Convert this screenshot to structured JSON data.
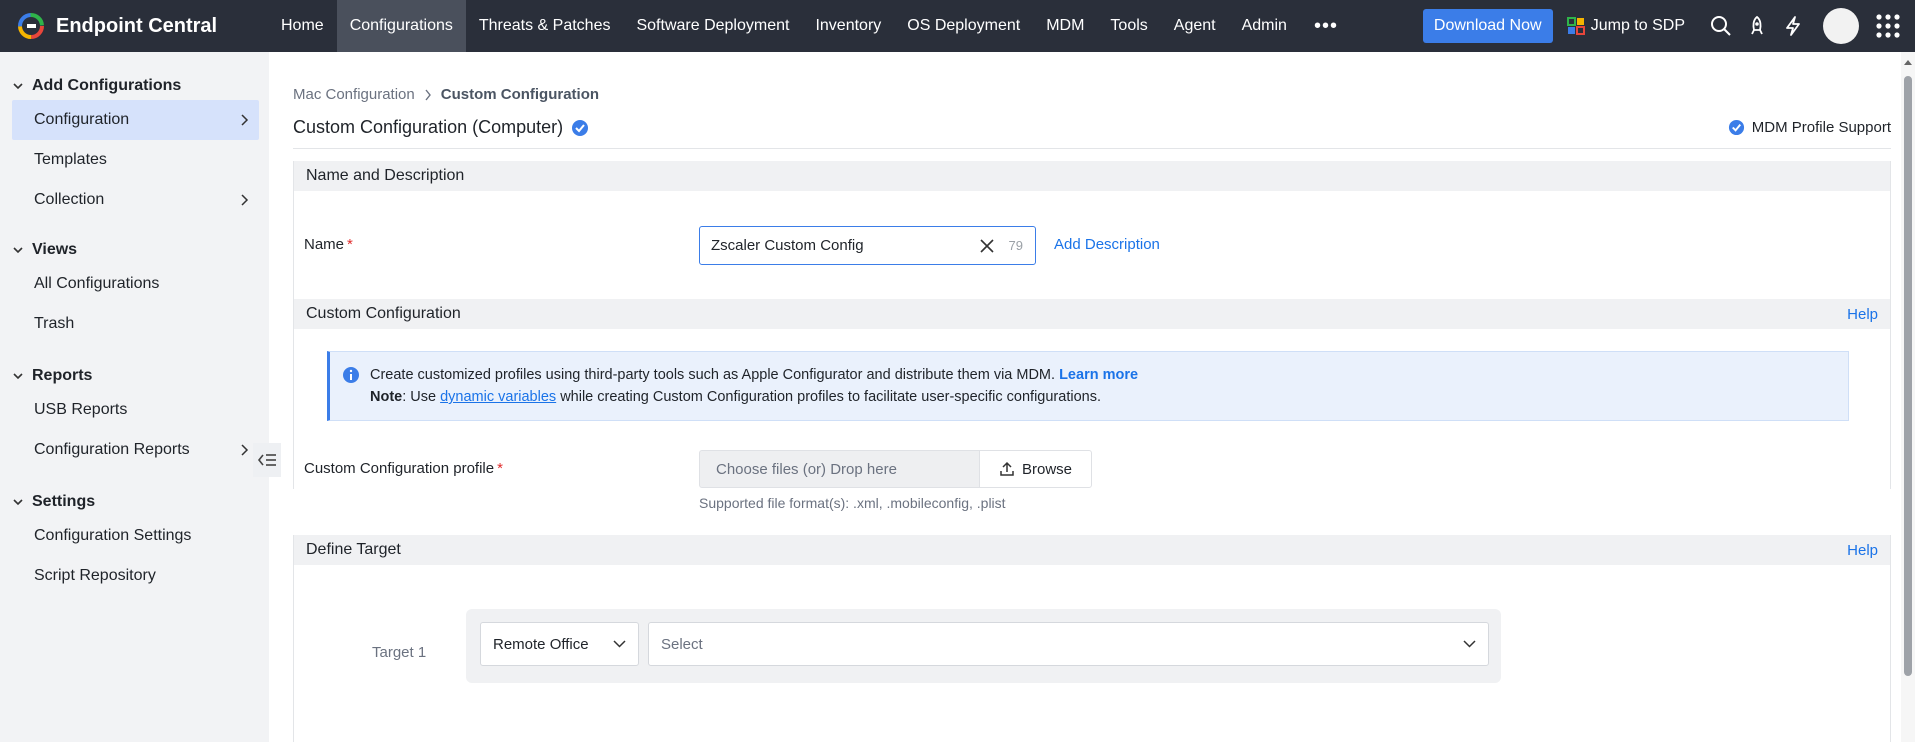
{
  "app": {
    "name": "Endpoint Central"
  },
  "nav": {
    "items": [
      "Home",
      "Configurations",
      "Threats & Patches",
      "Software Deployment",
      "Inventory",
      "OS Deployment",
      "MDM",
      "Tools",
      "Agent",
      "Admin"
    ],
    "active": "Configurations",
    "more_label": "•••"
  },
  "topbar": {
    "download_label": "Download Now",
    "jump_label": "Jump to SDP",
    "icons": [
      "search-icon",
      "rocket-icon",
      "lightning-icon",
      "avatar",
      "apps-grid-icon"
    ]
  },
  "sidebar": {
    "sections": [
      {
        "title": "Add Configurations",
        "items": [
          {
            "label": "Configuration",
            "has_arrow": true,
            "active": true
          },
          {
            "label": "Templates"
          },
          {
            "label": "Collection",
            "has_arrow": true
          }
        ]
      },
      {
        "title": "Views",
        "items": [
          {
            "label": "All Configurations"
          },
          {
            "label": "Trash"
          }
        ]
      },
      {
        "title": "Reports",
        "items": [
          {
            "label": "USB Reports"
          },
          {
            "label": "Configuration Reports",
            "has_arrow": true
          }
        ]
      },
      {
        "title": "Settings",
        "items": [
          {
            "label": "Configuration Settings"
          },
          {
            "label": "Script Repository"
          }
        ]
      }
    ]
  },
  "breadcrumb": {
    "parent": "Mac Configuration",
    "current": "Custom Configuration"
  },
  "page": {
    "title": "Custom Configuration (Computer)",
    "mdm_support": "MDM Profile Support"
  },
  "name_section": {
    "header": "Name and Description",
    "name_label": "Name",
    "required_mark": "*",
    "name_value": "Zscaler Custom Config",
    "char_count": "79",
    "add_description": "Add Description"
  },
  "custom_section": {
    "header": "Custom Configuration",
    "help": "Help",
    "info_line1": "Create customized profiles using third-party tools such as Apple Configurator and distribute them via MDM.",
    "learn_more": "Learn more",
    "note_label": "Note",
    "note_prefix": ": Use ",
    "note_link": "dynamic variables",
    "note_suffix": " while creating Custom Configuration profiles to facilitate user-specific configurations.",
    "profile_label": "Custom Configuration profile",
    "file_placeholder": "Choose files (or) Drop here",
    "browse_label": "Browse",
    "supported_formats": "Supported file format(s): .xml, .mobileconfig, .plist"
  },
  "target_section": {
    "header": "Define Target",
    "help": "Help",
    "target_label": "Target 1",
    "type_value": "Remote Office",
    "select_placeholder": "Select"
  },
  "colors": {
    "accent": "#3b7de8",
    "topbar": "#2a2f3a",
    "sidebar": "#f2f3f5",
    "link": "#1a73e8"
  }
}
